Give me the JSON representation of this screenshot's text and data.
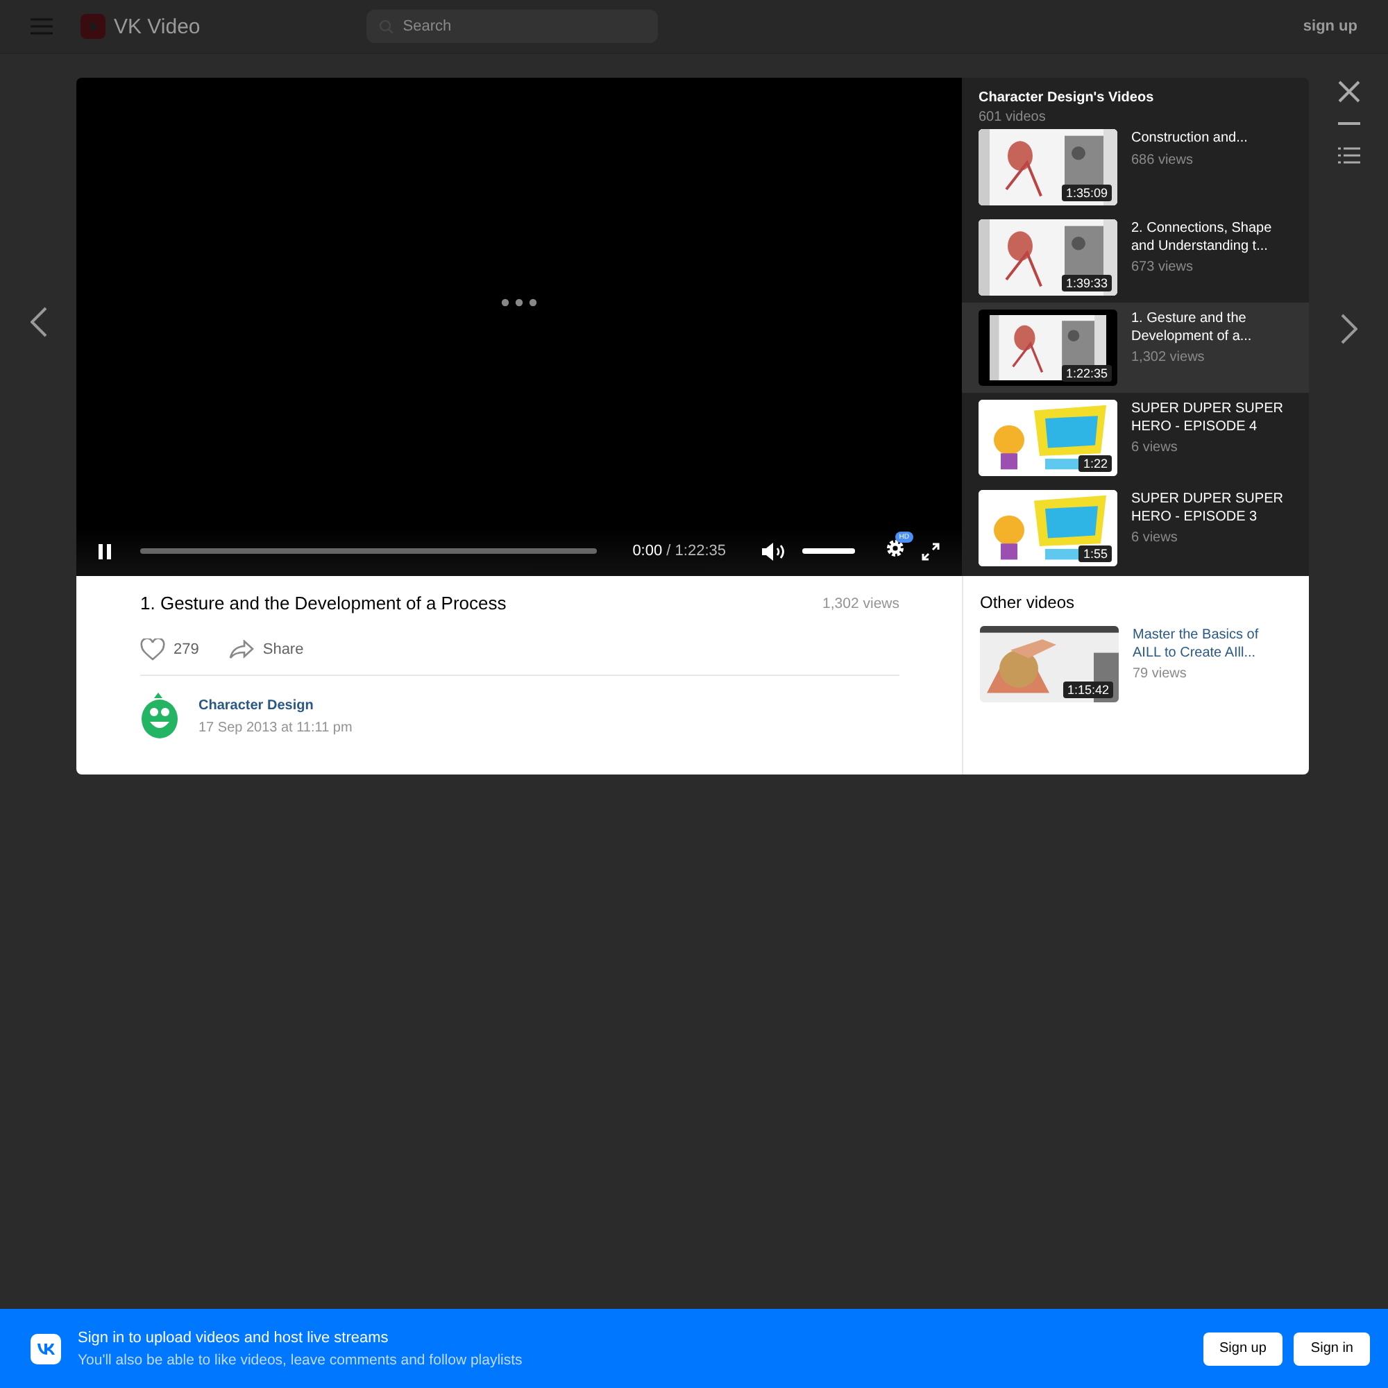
{
  "header": {
    "logo_text": "VK Video",
    "search": {
      "placeholder": "Search"
    },
    "sign_up": "sign up"
  },
  "player": {
    "time_current": "0:00",
    "time_separator": "/",
    "time_total": "1:22:35",
    "progress": {
      "level": 0
    },
    "volume": {
      "level": 1
    },
    "quality_badge": "HD"
  },
  "playlist": {
    "title": "Character Design's Videos",
    "count": "601 videos",
    "items": [
      {
        "title": "Construction and...",
        "views": "686 views",
        "duration": "1:35:09",
        "selected": false
      },
      {
        "title": "2. Connections, Shape and Understanding t...",
        "views": "673 views",
        "duration": "1:39:33",
        "selected": false
      },
      {
        "title": "1. Gesture and the Development of a...",
        "views": "1,302 views",
        "duration": "1:22:35",
        "selected": true
      },
      {
        "title": "SUPER DUPER SUPER HERO - EPISODE 4",
        "views": "6 views",
        "duration": "1:22",
        "selected": false
      },
      {
        "title": "SUPER DUPER SUPER HERO - EPISODE 3",
        "views": "6 views",
        "duration": "1:55",
        "selected": false
      }
    ]
  },
  "video": {
    "title": "1. Gesture and the Development of a Process",
    "views": "1,302 views",
    "likes": "279",
    "share": "Share",
    "channel": "Character Design",
    "date": "17 Sep 2013 at 11:11 pm"
  },
  "other_videos": {
    "heading": "Other videos",
    "items": [
      {
        "title": "Master the Basics of AILL to Create AIll...",
        "views": "79 views",
        "duration": "1:15:42"
      }
    ]
  },
  "banner": {
    "title": "Sign in to upload videos and host live streams",
    "subtitle": "You'll also be able to like videos, leave comments and follow playlists",
    "buttons": [
      "Sign up",
      "Sign in"
    ]
  }
}
